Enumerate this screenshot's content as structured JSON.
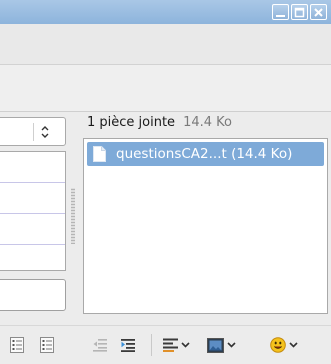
{
  "window": {
    "buttons": [
      {
        "name": "minimize",
        "icon": "minimize-icon"
      },
      {
        "name": "maximize",
        "icon": "maximize-icon"
      },
      {
        "name": "close",
        "icon": "close-icon"
      }
    ]
  },
  "attachments": {
    "count_label": "1 pièce jointe",
    "total_size": "14.4 Ko",
    "items": [
      {
        "label": "questionsCA2...t (14.4 Ko)",
        "icon": "file-icon",
        "selected": true
      }
    ]
  },
  "format_toolbar": {
    "buttons": [
      {
        "name": "bulleted-list",
        "icon": "bulleted-list-icon",
        "enabled": true
      },
      {
        "name": "numbered-list",
        "icon": "numbered-list-icon",
        "enabled": true
      },
      {
        "name": "decrease-indent",
        "icon": "decrease-indent-icon",
        "enabled": false
      },
      {
        "name": "increase-indent",
        "icon": "increase-indent-icon",
        "enabled": true
      },
      {
        "name": "text-align",
        "icon": "text-align-icon",
        "dropdown": true
      },
      {
        "name": "insert-image",
        "icon": "insert-image-icon",
        "dropdown": true
      },
      {
        "name": "insert-smiley",
        "icon": "smiley-icon",
        "dropdown": true
      }
    ]
  },
  "colors": {
    "titlebar": "#9fc0e3",
    "selection": "#7eaad8",
    "background": "#ececec"
  }
}
